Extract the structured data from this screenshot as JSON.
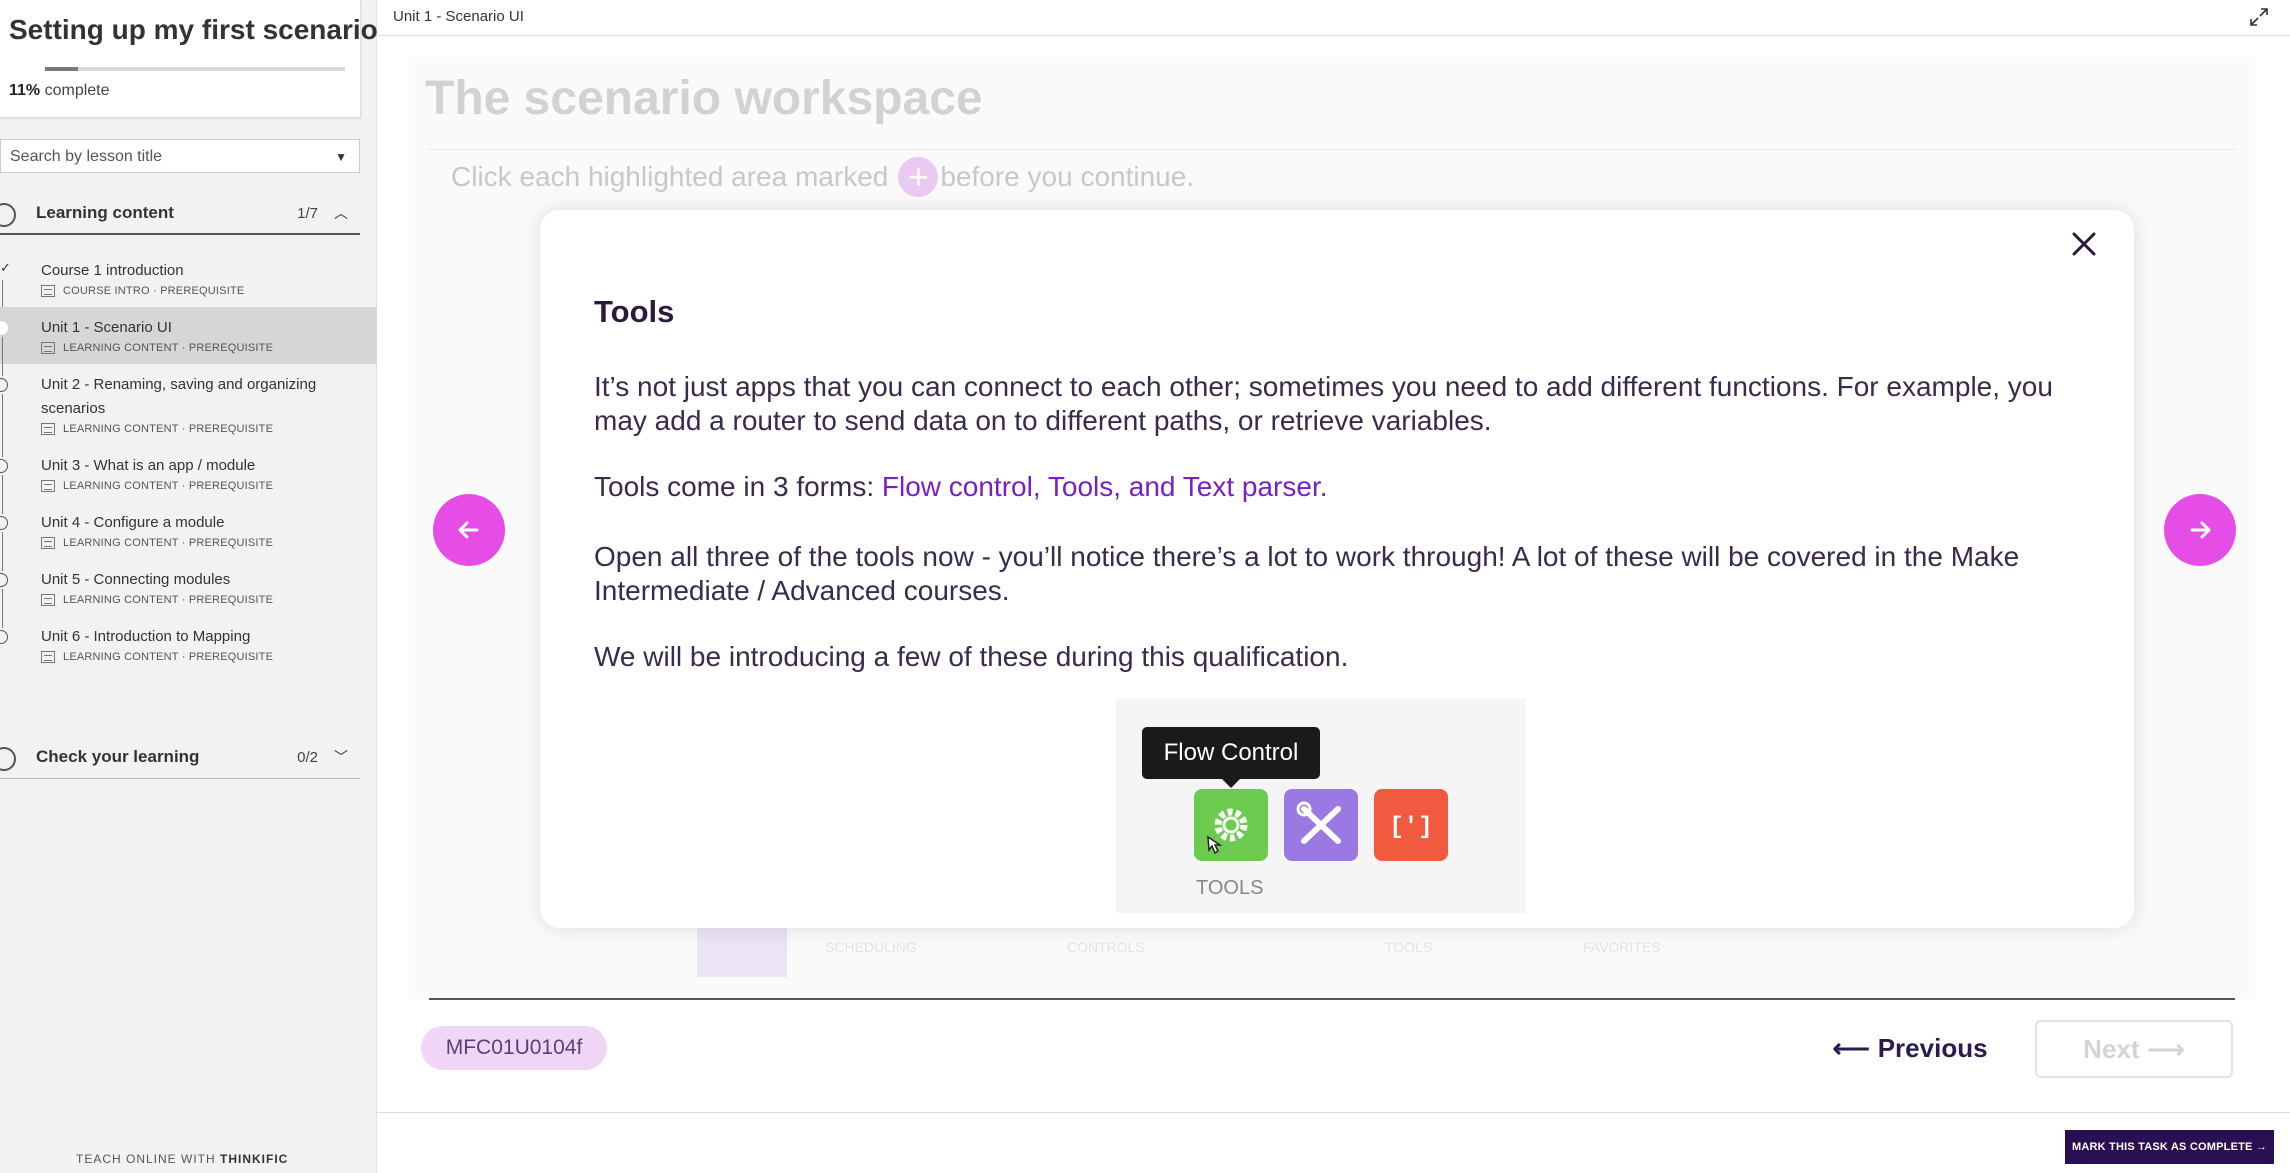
{
  "course": {
    "title": "Setting up my first scenario",
    "progress_percent": 11,
    "progress_value": "11%",
    "progress_suffix": "complete"
  },
  "search": {
    "placeholder": "Search by lesson title"
  },
  "sections": [
    {
      "label": "Learning content",
      "count": "1/7",
      "expanded": true
    },
    {
      "label": "Check your learning",
      "count": "0/2",
      "expanded": false
    }
  ],
  "lessons": [
    {
      "title": "Course 1 introduction",
      "meta": "COURSE INTRO · PREREQUISITE",
      "completed": true
    },
    {
      "title": "Unit 1 - Scenario UI",
      "meta": "LEARNING CONTENT · PREREQUISITE",
      "active": true
    },
    {
      "title": "Unit 2 - Renaming, saving and organizing scenarios",
      "meta": "LEARNING CONTENT · PREREQUISITE"
    },
    {
      "title": "Unit 3 - What is an app / module",
      "meta": "LEARNING CONTENT · PREREQUISITE"
    },
    {
      "title": "Unit 4 - Configure a module",
      "meta": "LEARNING CONTENT · PREREQUISITE"
    },
    {
      "title": "Unit 5 - Connecting modules",
      "meta": "LEARNING CONTENT · PREREQUISITE"
    },
    {
      "title": "Unit 6 - Introduction to Mapping",
      "meta": "LEARNING CONTENT · PREREQUISITE"
    }
  ],
  "footer": {
    "prefix": "TEACH ONLINE WITH",
    "brand": "THINKIFIC"
  },
  "topbar": {
    "title": "Unit 1 - Scenario UI"
  },
  "background": {
    "title": "The scenario workspace",
    "instruction_before": "Click each highlighted area marked",
    "instruction_after": "before you continue.",
    "labels": [
      "SCHEDULING",
      "CONTROLS",
      "TOOLS",
      "FAVORITES"
    ]
  },
  "modal": {
    "title": "Tools",
    "p1": "It’s not just apps that you can connect to each other; sometimes you need to add different functions. For example, you may add a router to send data on to different paths, or retrieve variables.",
    "p2_before": "Tools come in 3 forms: ",
    "p2_highlight": "Flow control, Tools, and Text parser.",
    "p3": "Open all three of the tools now - you’ll notice there’s a lot to work through! A lot of these will be covered in the Make Intermediate / Advanced courses.",
    "p4": "We will be introducing a few of these during this qualification.",
    "image": {
      "tooltip": "Flow Control",
      "label": "TOOLS",
      "text_tool_glyph": "[']"
    }
  },
  "controls": {
    "task_code": "MFC01U0104f",
    "previous": "Previous",
    "next": "Next",
    "complete": "MARK THIS TASK AS COMPLETE"
  },
  "colors": {
    "accent": "#e64ce6",
    "highlight": "#7a1fc4",
    "complete_button": "#2a0f52",
    "tool_flow": "#6ccb4e",
    "tool_tools": "#9b79e2",
    "tool_text": "#f05a3e"
  }
}
